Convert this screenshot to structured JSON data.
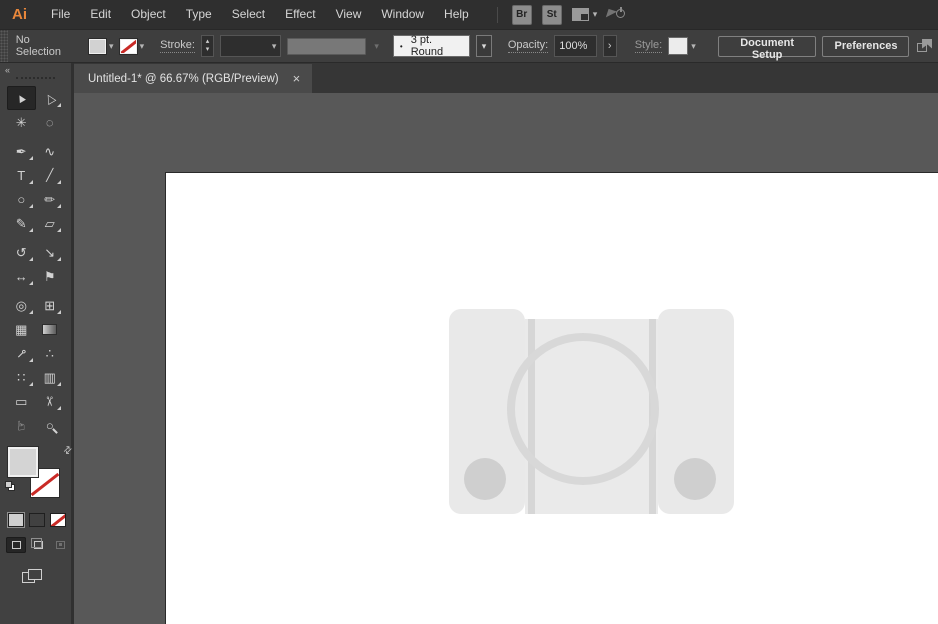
{
  "app": {
    "logo_text": "Ai",
    "logo_color": "#e8873b",
    "name": "Adobe Illustrator"
  },
  "glyphs": {
    "chevron_down": "▾",
    "chevron_up": "▴",
    "arrow_right": "›",
    "swap": "⇄",
    "collapse": "«",
    "close": "×",
    "brush_dot": "•"
  },
  "menu_bar": {
    "items": [
      "File",
      "Edit",
      "Object",
      "Type",
      "Select",
      "Effect",
      "View",
      "Window",
      "Help"
    ],
    "bridge_label": "Br",
    "stock_label": "St"
  },
  "control_bar": {
    "selection_status": "No Selection",
    "fill_swatch_color": "#d2d2d2",
    "stroke_swatch": "none",
    "stroke_label": "Stroke:",
    "stroke_weight_value": "",
    "brush_value": "3 pt. Round",
    "opacity_label": "Opacity:",
    "opacity_value": "100%",
    "style_label": "Style:",
    "document_setup_label": "Document Setup",
    "preferences_label": "Preferences"
  },
  "document_tab": {
    "title": "Untitled-1* @ 66.67% (RGB/Preview)"
  },
  "toolbar": {
    "fill_color": "#d4d4d4",
    "stroke_color": "none",
    "tools": [
      {
        "name": "selection",
        "glyph": "▲",
        "selected": true
      },
      {
        "name": "direct-selection",
        "glyph": "△",
        "fly": true
      },
      {
        "name": "magic-wand",
        "glyph": "✳"
      },
      {
        "name": "lasso",
        "glyph": "◌",
        "group_end": true
      },
      {
        "name": "pen",
        "glyph": "✒",
        "fly": true
      },
      {
        "name": "curvature",
        "glyph": "∿"
      },
      {
        "name": "type",
        "glyph": "T",
        "fly": true
      },
      {
        "name": "line-segment",
        "glyph": "╱",
        "fly": true
      },
      {
        "name": "ellipse",
        "glyph": "○",
        "fly": true
      },
      {
        "name": "paintbrush",
        "glyph": "✏",
        "fly": true
      },
      {
        "name": "shaper",
        "glyph": "✎",
        "fly": true
      },
      {
        "name": "eraser",
        "glyph": "▱",
        "fly": true,
        "group_end": true
      },
      {
        "name": "rotate",
        "glyph": "↺",
        "fly": true
      },
      {
        "name": "scale",
        "glyph": "↘",
        "fly": true
      },
      {
        "name": "width",
        "glyph": "↔",
        "fly": true
      },
      {
        "name": "puppet-warp",
        "glyph": "⚑",
        "group_end": true
      },
      {
        "name": "shape-builder",
        "glyph": "◎",
        "fly": true
      },
      {
        "name": "perspective-grid",
        "glyph": "⊞",
        "fly": true
      },
      {
        "name": "mesh",
        "glyph": "▦"
      },
      {
        "name": "gradient",
        "glyph": ""
      },
      {
        "name": "eyedropper",
        "glyph": "⊸",
        "fly": true
      },
      {
        "name": "blend",
        "glyph": "∴"
      },
      {
        "name": "symbol-sprayer",
        "glyph": "∷",
        "fly": true
      },
      {
        "name": "column-graph",
        "glyph": "▥",
        "fly": true
      },
      {
        "name": "artboard",
        "glyph": "▭"
      },
      {
        "name": "slice",
        "glyph": "✂",
        "fly": true
      },
      {
        "name": "hand",
        "glyph": "☞"
      },
      {
        "name": "zoom",
        "glyph": "○"
      }
    ],
    "mini_buttons": [
      {
        "name": "color",
        "selected": true
      },
      {
        "name": "gradient",
        "selected": false
      },
      {
        "name": "none",
        "selected": false
      }
    ],
    "drawing_modes": [
      {
        "name": "draw-normal",
        "selected": true
      },
      {
        "name": "draw-behind",
        "selected": false
      },
      {
        "name": "draw-inside",
        "selected": false,
        "disabled": true
      }
    ]
  },
  "canvas": {
    "workspace_color": "#585858",
    "artboard_color": "#ffffff",
    "artwork": {
      "name": "playstation-console-sketch",
      "body_fill": "#e9e9e9",
      "divider_fill": "#d6d6d6",
      "disc_ring_color": "#d8d8d8",
      "button_fill": "#cfcfcf"
    }
  }
}
